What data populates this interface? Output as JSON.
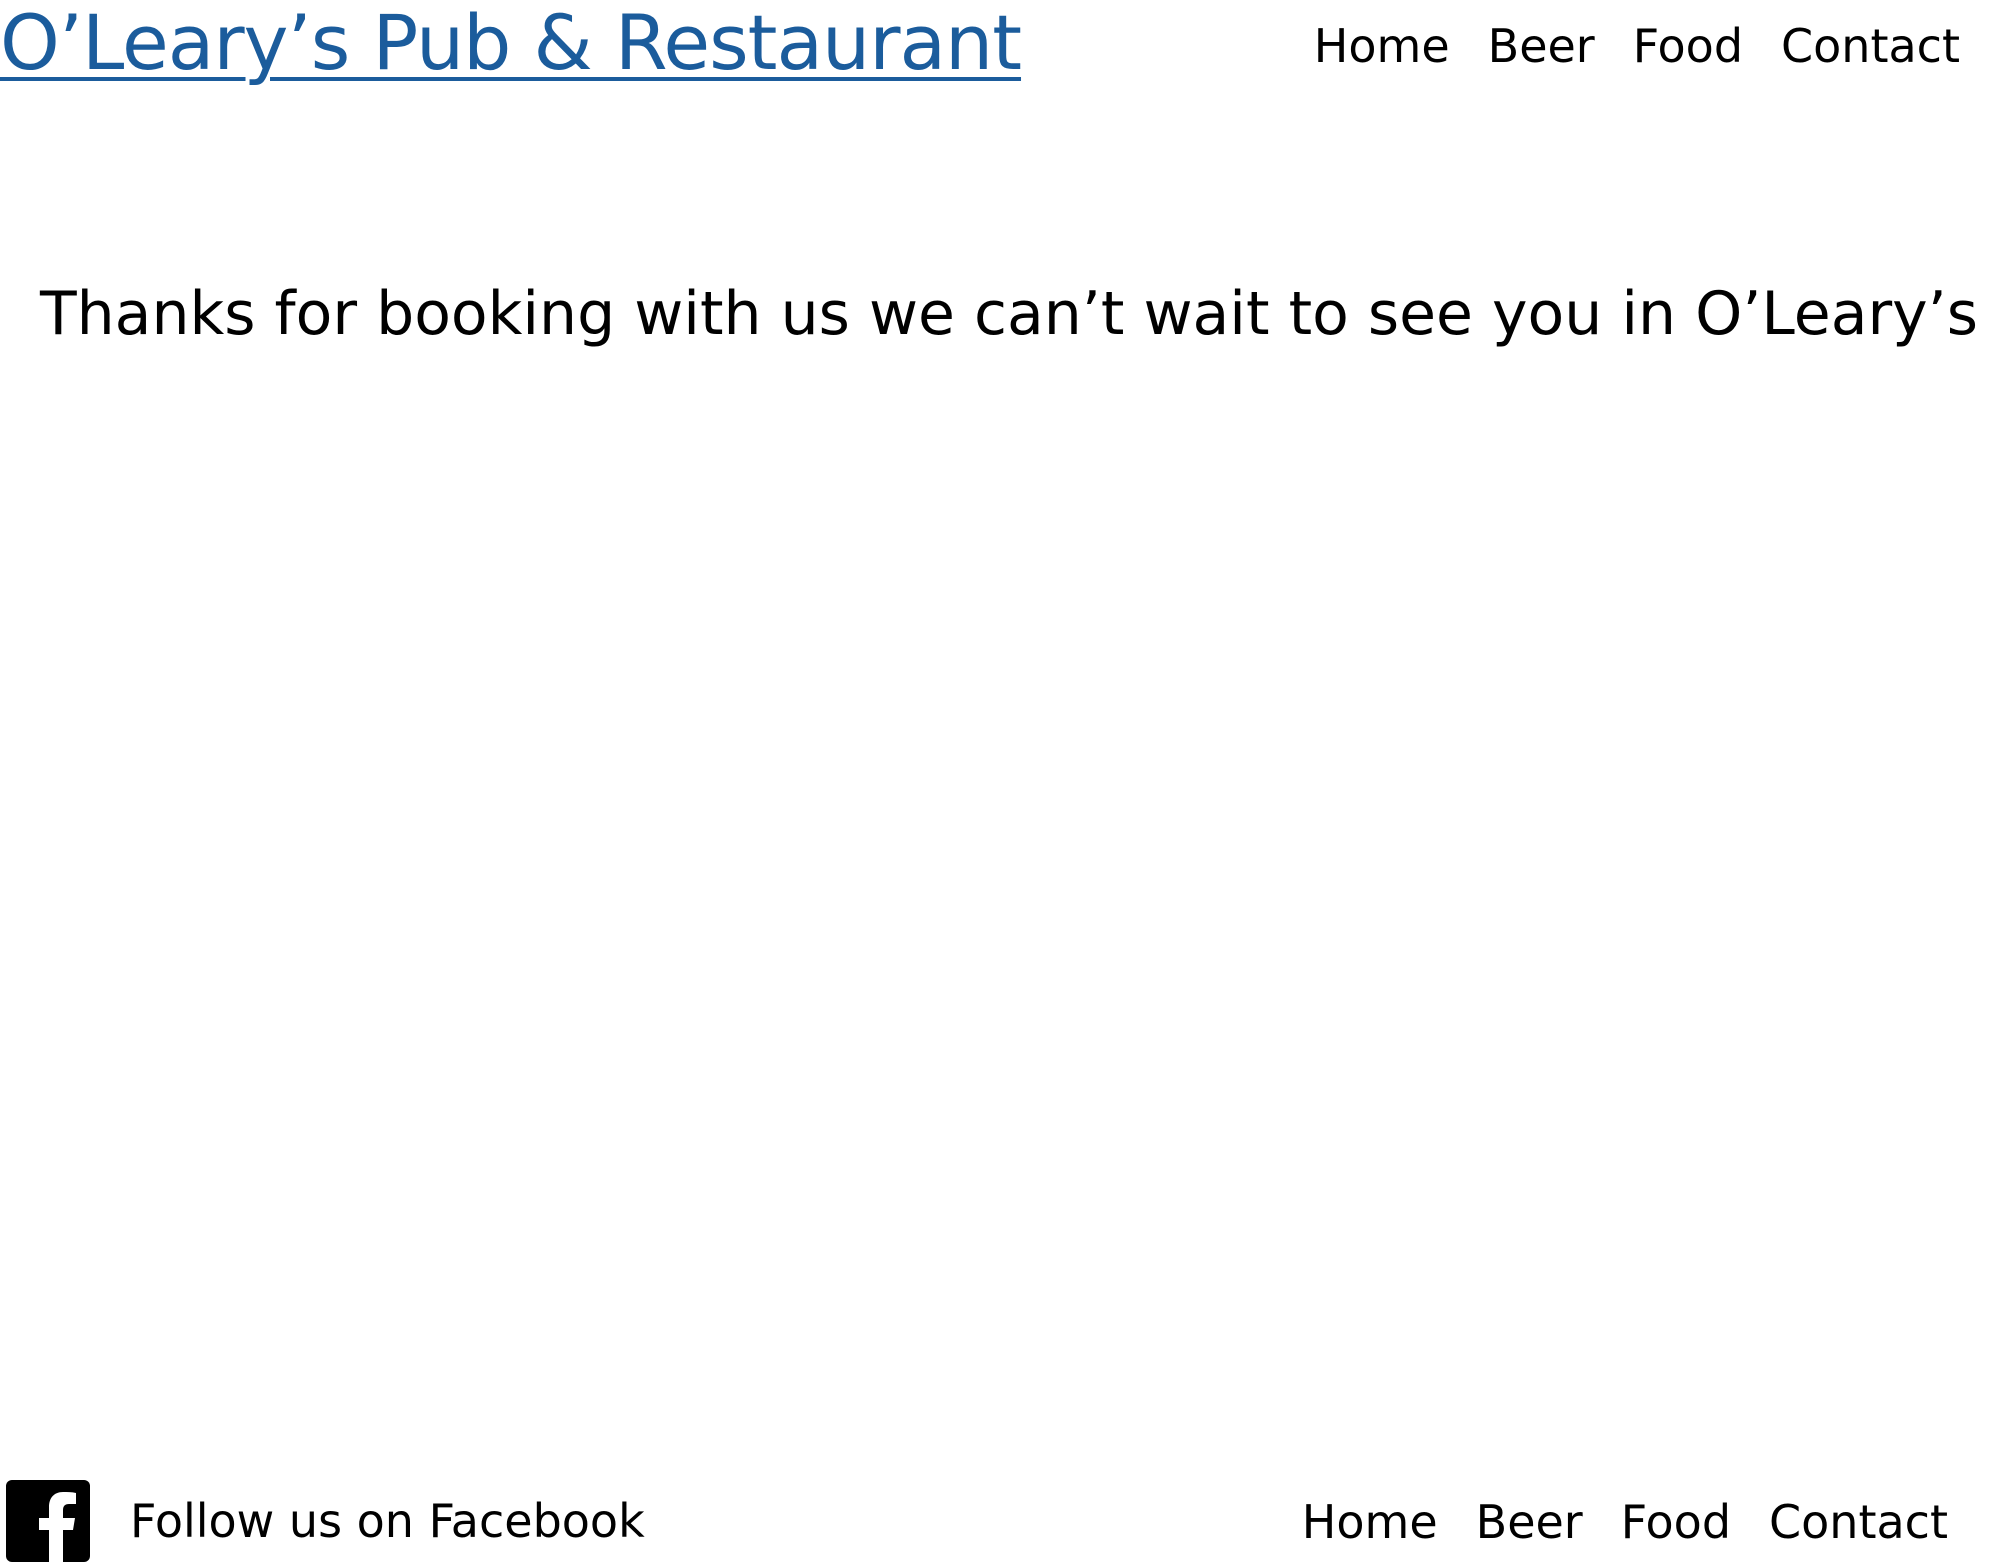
{
  "header": {
    "title": "O’Leary’s Pub & Restaurant",
    "nav": [
      {
        "label": "Home"
      },
      {
        "label": "Beer"
      },
      {
        "label": "Food"
      },
      {
        "label": "Contact"
      }
    ]
  },
  "main": {
    "message": "Thanks for booking with us we can’t wait to see you in O’Leary’s"
  },
  "footer": {
    "facebook_label": "Follow us on Facebook",
    "facebook_icon": "facebook-icon",
    "nav": [
      {
        "label": "Home"
      },
      {
        "label": "Beer"
      },
      {
        "label": "Food"
      },
      {
        "label": "Contact"
      }
    ]
  },
  "colors": {
    "title": "#1b5c9c",
    "text": "#000000",
    "background": "#ffffff"
  }
}
